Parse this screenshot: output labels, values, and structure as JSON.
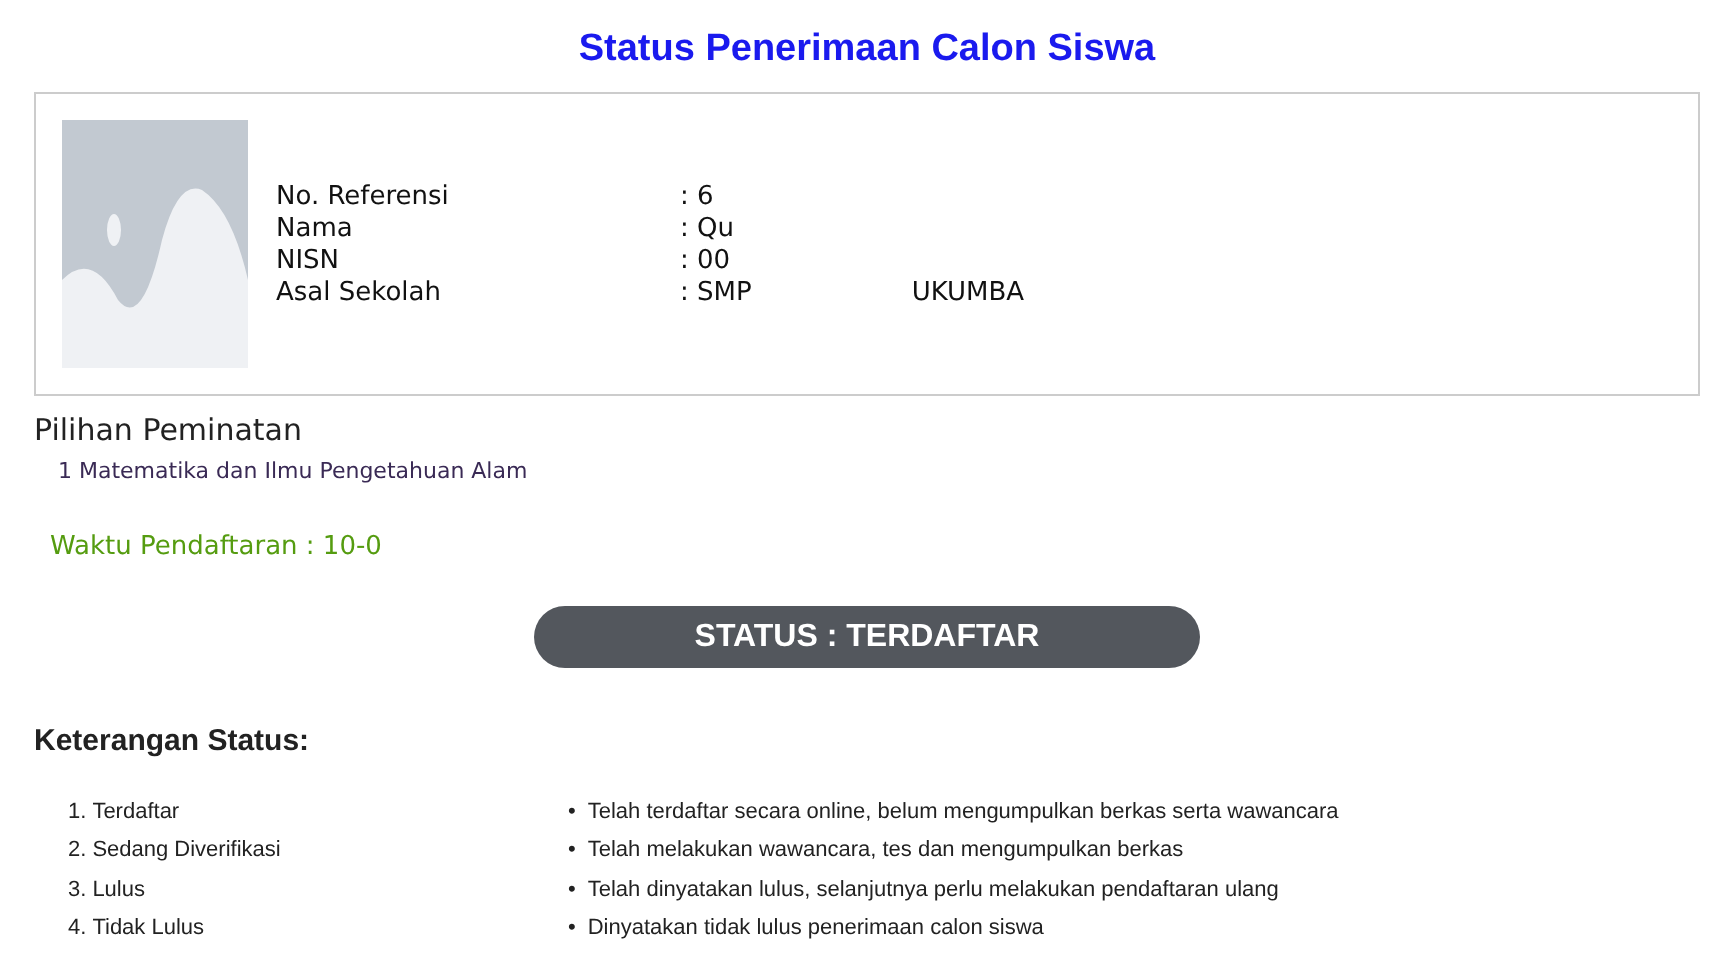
{
  "title": "Status Penerimaan Calon Siswa",
  "profile": {
    "fields": [
      {
        "label": "No. Referensi",
        "value": ": 6"
      },
      {
        "label": "Nama",
        "value": ": Qu"
      },
      {
        "label": "NISN",
        "value": ": 00"
      },
      {
        "label": "Asal Sekolah",
        "value": ": SMP",
        "value_end": "UKUMBA"
      }
    ]
  },
  "peminatan": {
    "heading": "Pilihan Peminatan",
    "items": [
      "1 Matematika dan Ilmu Pengetahuan Alam"
    ]
  },
  "waktu": "Waktu Pendaftaran : 10-0",
  "status": "STATUS : TERDAFTAR",
  "keterangan": {
    "heading": "Keterangan Status:",
    "rows": [
      {
        "number": "1.",
        "name": "Terdaftar",
        "bullet": "•",
        "description": "Telah terdaftar secara online, belum mengumpulkan berkas serta wawancara"
      },
      {
        "number": "2.",
        "name": "Sedang Diverifikasi",
        "bullet": "•",
        "description": "Telah melakukan wawancara, tes dan mengumpulkan berkas"
      },
      {
        "number": "3.",
        "name": "Lulus",
        "bullet": "•",
        "description": "Telah dinyatakan lulus, selanjutnya perlu melakukan pendaftaran ulang"
      },
      {
        "number": "4.",
        "name": "Tidak Lulus",
        "bullet": "•",
        "description": "Dinyatakan tidak lulus penerimaan calon siswa"
      }
    ]
  }
}
